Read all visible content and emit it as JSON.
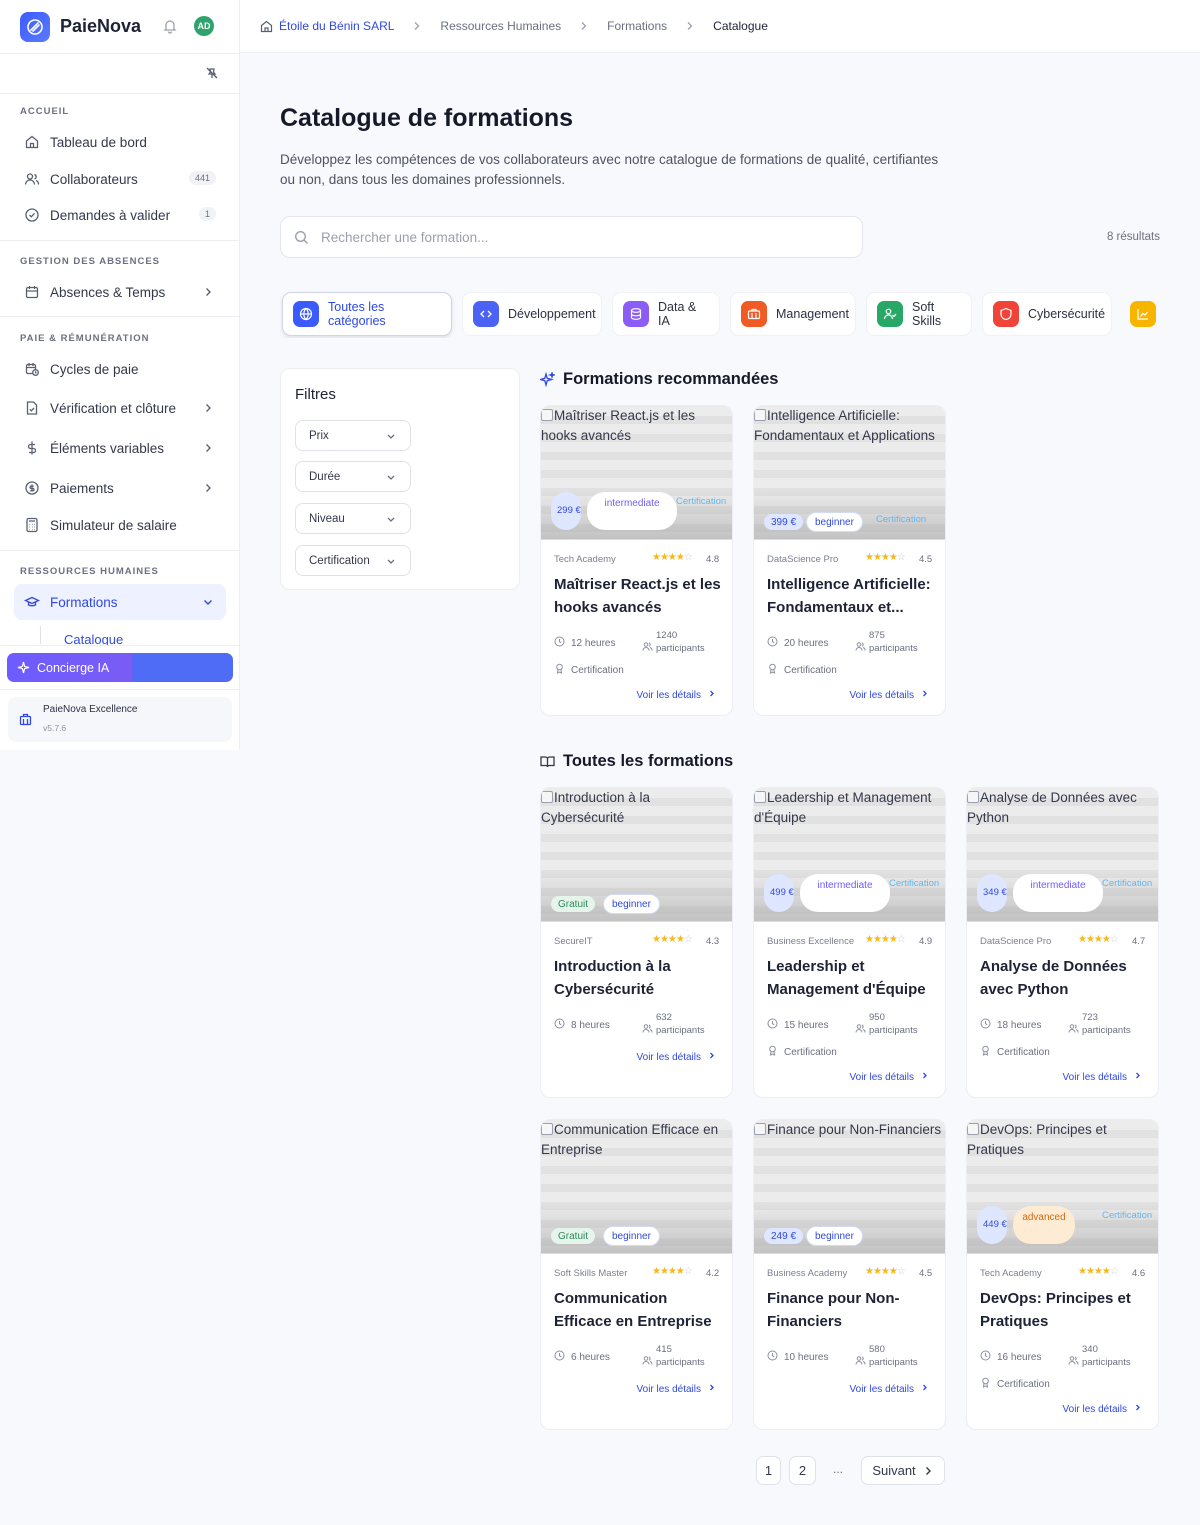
{
  "brand": {
    "name": "PaieNova",
    "avatar": "AD"
  },
  "sidebar": {
    "sections": [
      "ACCUEIL",
      "GESTION DES ABSENCES",
      "PAIE & RÉMUNÉRATION",
      "RESSOURCES HUMAINES"
    ],
    "items": [
      {
        "label": "Tableau de bord",
        "icon": "home-icon"
      },
      {
        "label": "Collaborateurs",
        "icon": "users-icon",
        "badge": "441"
      },
      {
        "label": "Demandes à valider",
        "icon": "check-circle-icon",
        "badge": "1"
      },
      {
        "label": "Absences & Temps",
        "icon": "calendar-icon"
      },
      {
        "label": "Cycles de paie",
        "icon": "calendar-clock-icon"
      },
      {
        "label": "Vérification et clôture",
        "icon": "file-check-icon"
      },
      {
        "label": "Éléments variables",
        "icon": "dollar-icon"
      },
      {
        "label": "Paiements",
        "icon": "coin-icon"
      },
      {
        "label": "Simulateur de salaire",
        "icon": "calculator-icon"
      },
      {
        "label": "Formations",
        "icon": "graduation-cap-icon"
      }
    ],
    "sub_item": "Catalogue",
    "concierge": "Concierge IA",
    "company": {
      "name": "PaieNova Excellence",
      "version": "v5.7.6"
    }
  },
  "breadcrumb": [
    "Étoile du Bénin SARL",
    "Ressources Humaines",
    "Formations",
    "Catalogue"
  ],
  "page": {
    "title": "Catalogue de formations",
    "description": "Développez les compétences de vos collaborateurs avec notre catalogue de formations de qualité, certifiantes ou non, dans tous les domaines professionnels.",
    "search_placeholder": "Rechercher une formation...",
    "results": "8 résultats"
  },
  "categories": [
    {
      "label": "Toutes les catégories",
      "color": "#3b5bff",
      "active": true
    },
    {
      "label": "Développement",
      "color": "#4a63f5"
    },
    {
      "label": "Data & IA",
      "color": "#8b5cf6"
    },
    {
      "label": "Management",
      "color": "#f15a24"
    },
    {
      "label": "Soft Skills",
      "color": "#27a866"
    },
    {
      "label": "Cybersécurité",
      "color": "#f04438"
    },
    {
      "label": "",
      "color": "#f7b500"
    }
  ],
  "filters": {
    "title": "Filtres",
    "selects": [
      "Prix",
      "Durée",
      "Niveau",
      "Certification"
    ]
  },
  "sections": {
    "recommended": "Formations recommandées",
    "all": "Toutes les formations"
  },
  "labels": {
    "details": "Voir les détails",
    "hours_suffix": "heures",
    "participants": "participants",
    "certification": "Certification"
  },
  "recommended": [
    {
      "alt": "Maîtriser React.js et les hooks avancés",
      "price": "299 €",
      "level": "intermediate",
      "cert": "Certification",
      "provider": "Tech Academy",
      "rating": "4.8",
      "title": "Maîtriser React.js et les hooks avancés",
      "hours": "12 heures",
      "participants": "1240",
      "certified": true
    },
    {
      "alt": "Intelligence Artificielle: Fondamentaux et Applications",
      "price": "399 €",
      "level": "beginner",
      "cert": "Certification",
      "provider": "DataScience Pro",
      "rating": "4.5",
      "title": "Intelligence Artificielle: Fondamentaux et...",
      "hours": "20 heures",
      "participants": "875",
      "certified": true
    }
  ],
  "courses": [
    {
      "alt": "Introduction à la Cybersécurité",
      "price": "Gratuit",
      "level": "beginner",
      "provider": "SecureIT",
      "rating": "4.3",
      "title": "Introduction à la Cybersécurité",
      "hours": "8 heures",
      "participants": "632",
      "certified": false
    },
    {
      "alt": "Leadership et Management d'Équipe",
      "price": "499 €",
      "level": "intermediate",
      "cert": "Certification",
      "provider": "Business Excellence",
      "rating": "4.9",
      "title": "Leadership et Management d'Équipe",
      "hours": "15 heures",
      "participants": "950",
      "certified": true
    },
    {
      "alt": "Analyse de Données avec Python",
      "price": "349 €",
      "level": "intermediate",
      "cert": "Certification",
      "provider": "DataScience Pro",
      "rating": "4.7",
      "title": "Analyse de Données avec Python",
      "hours": "18 heures",
      "participants": "723",
      "certified": true
    },
    {
      "alt": "Communication Efficace en Entreprise",
      "price": "Gratuit",
      "level": "beginner",
      "provider": "Soft Skills Master",
      "rating": "4.2",
      "title": "Communication Efficace en Entreprise",
      "hours": "6 heures",
      "participants": "415",
      "certified": false
    },
    {
      "alt": "Finance pour Non-Financiers",
      "price": "249 €",
      "level": "beginner",
      "provider": "Business Academy",
      "rating": "4.5",
      "title": "Finance pour Non-Financiers",
      "hours": "10 heures",
      "participants": "580",
      "certified": false
    },
    {
      "alt": "DevOps: Principes et Pratiques",
      "price": "449 €",
      "level": "advanced",
      "cert": "Certification",
      "provider": "Tech Academy",
      "rating": "4.6",
      "title": "DevOps: Principes et Pratiques",
      "hours": "16 heures",
      "participants": "340",
      "certified": true
    }
  ],
  "pagination": {
    "pages": [
      "1",
      "2"
    ],
    "ellipsis": "...",
    "next": "Suivant"
  }
}
